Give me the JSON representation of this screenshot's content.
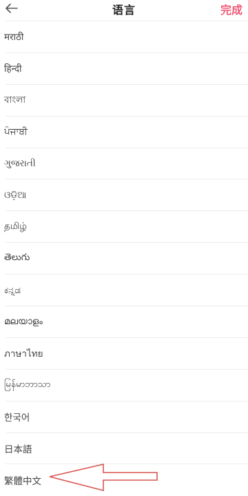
{
  "header": {
    "title": "语言",
    "done_label": "完成",
    "back_icon": "back-arrow-icon"
  },
  "colors": {
    "accent": "#f05a78",
    "annotation": "#d9534f",
    "divider": "#ececec"
  },
  "languages": [
    "मराठी",
    "हिन्दी",
    "বাংলা",
    "ਪੰਜਾਬੀ",
    "ગુજરાતી",
    "ଓଡ଼ିଆ",
    "தமிழ்",
    "తెలుగు",
    "ಕನ್ನಡ",
    "മലയാളം",
    "ภาษาไทย",
    "မြန်မာဘာသာ",
    "한국어",
    "日本語",
    "繁體中文"
  ]
}
